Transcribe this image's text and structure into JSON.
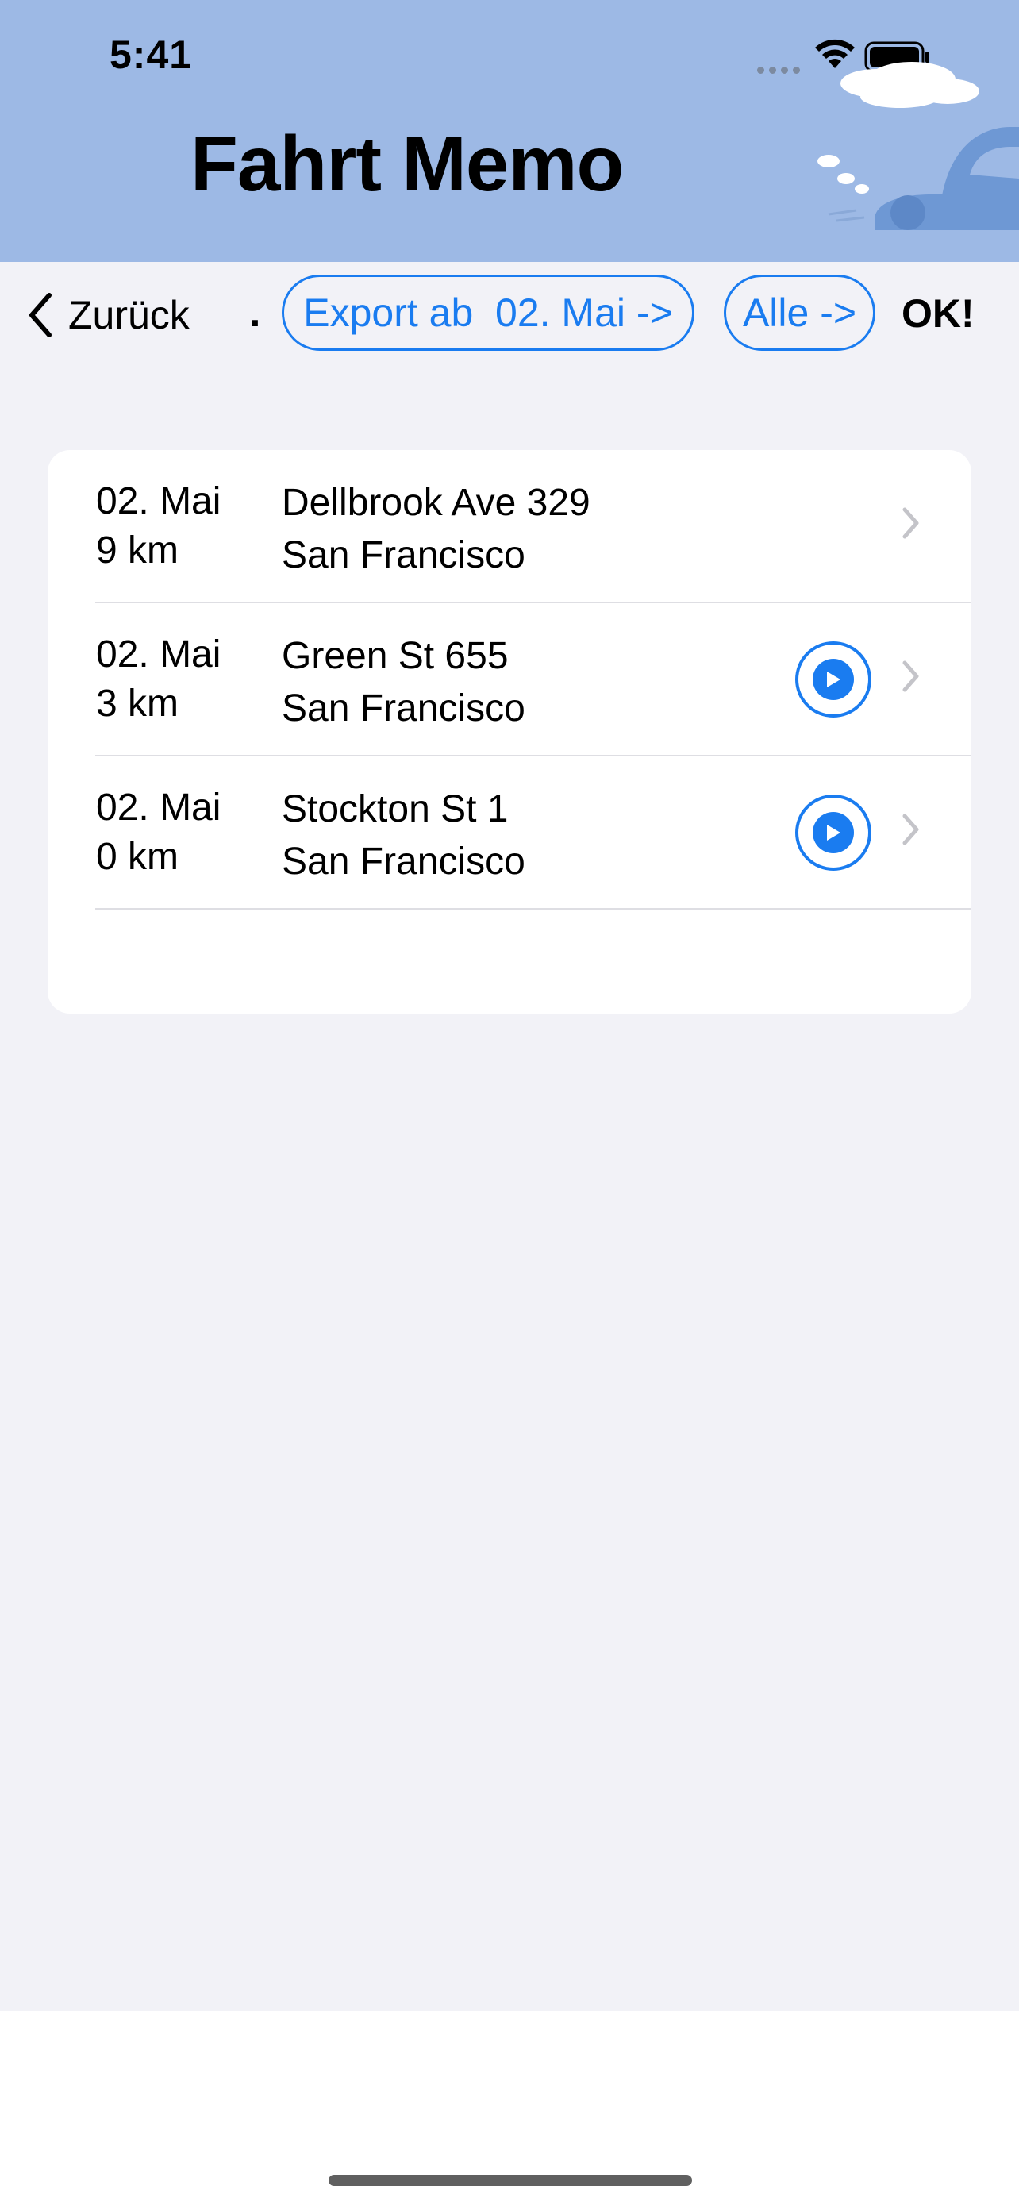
{
  "status_bar": {
    "time": "5:41"
  },
  "header": {
    "title": "Fahrt Memo"
  },
  "toolbar": {
    "back_label": "Zurück",
    "dot": ".",
    "export_label": "Export ab  02. Mai ->",
    "alle_label": "Alle ->",
    "ok_label": "OK!"
  },
  "trips": [
    {
      "date": "02. Mai",
      "distance": "9 km",
      "street": "Dellbrook Ave 329",
      "city": "San Francisco",
      "has_play": false
    },
    {
      "date": "02. Mai",
      "distance": "3 km",
      "street": "Green St 655",
      "city": "San Francisco",
      "has_play": true
    },
    {
      "date": "02. Mai",
      "distance": "0 km",
      "street": "Stockton St 1",
      "city": "San Francisco",
      "has_play": true
    }
  ],
  "colors": {
    "accent": "#1a7cf0",
    "header_bg": "#9db9e5",
    "page_bg": "#f2f2f7"
  },
  "icons": [
    "wifi-icon",
    "battery-icon",
    "chevron-left-icon",
    "play-icon",
    "chevron-right-icon",
    "car-cloud-illustration"
  ]
}
